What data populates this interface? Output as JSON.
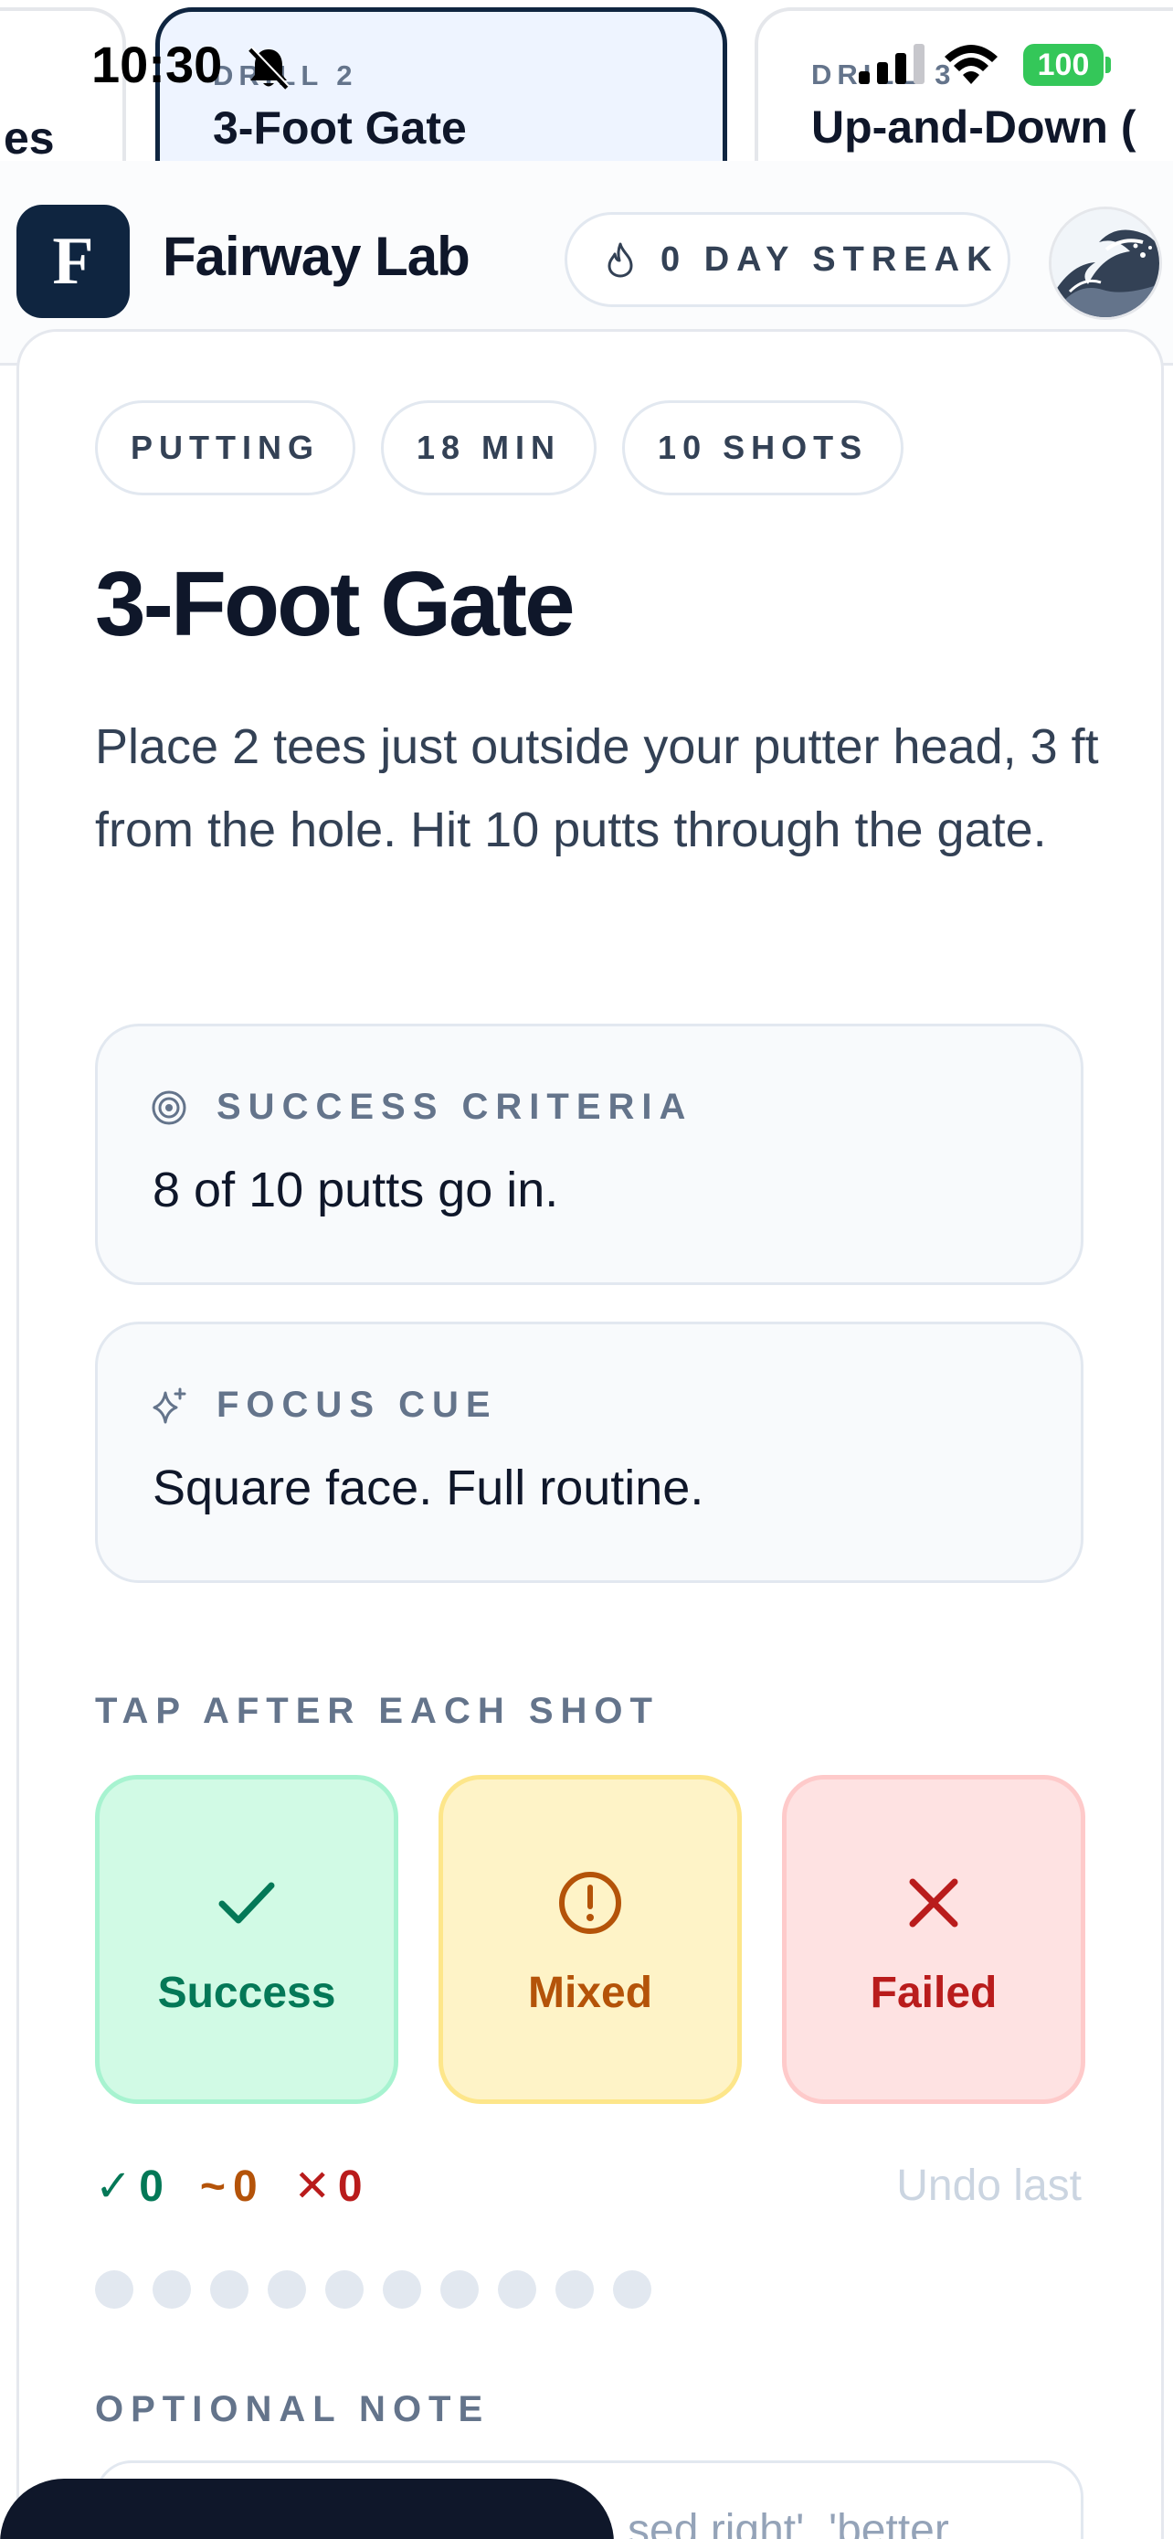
{
  "status_bar": {
    "time": "10:30",
    "battery": "100"
  },
  "carousel": [
    {
      "kicker": "",
      "title": "es"
    },
    {
      "kicker": "DRILL 2",
      "title": "3-Foot Gate"
    },
    {
      "kicker": "DRILL 3",
      "title": "Up-and-Down ("
    }
  ],
  "header": {
    "logo_letter": "F",
    "brand": "Fairway Lab",
    "streak_label": "0 DAY STREAK",
    "avatar_icon": "great-wave-avatar"
  },
  "drill": {
    "chips": [
      "PUTTING",
      "18 MIN",
      "10 SHOTS"
    ],
    "title": "3-Foot Gate",
    "description": "Place 2 tees just outside your putter head, 3 ft from the hole. Hit 10 putts through the gate.",
    "success_criteria": {
      "label": "SUCCESS CRITERIA",
      "text": "8 of 10 putts go in.",
      "icon": "target-icon"
    },
    "focus_cue": {
      "label": "FOCUS CUE",
      "text": "Square face. Full routine.",
      "icon": "sparkle-icon"
    }
  },
  "shots": {
    "section_label": "TAP AFTER EACH SHOT",
    "buttons": [
      {
        "label": "Success",
        "icon": "check-icon",
        "color": "#047857"
      },
      {
        "label": "Mixed",
        "icon": "alert-circle-icon",
        "color": "#b45309"
      },
      {
        "label": "Failed",
        "icon": "x-icon",
        "color": "#b91c1c"
      }
    ],
    "tally": {
      "success_symbol": "✓",
      "success": "0",
      "mixed_symbol": "~",
      "mixed": "0",
      "failed_symbol": "✕",
      "failed": "0"
    },
    "undo_label": "Undo last",
    "progress_total": 10,
    "progress_done": 0
  },
  "note": {
    "section_label": "OPTIONAL NOTE",
    "placeholder_visible": "sed right', 'better"
  },
  "colors": {
    "brand": "#0f2540",
    "success": "#047857",
    "mixed": "#b45309",
    "failed": "#b91c1c"
  }
}
